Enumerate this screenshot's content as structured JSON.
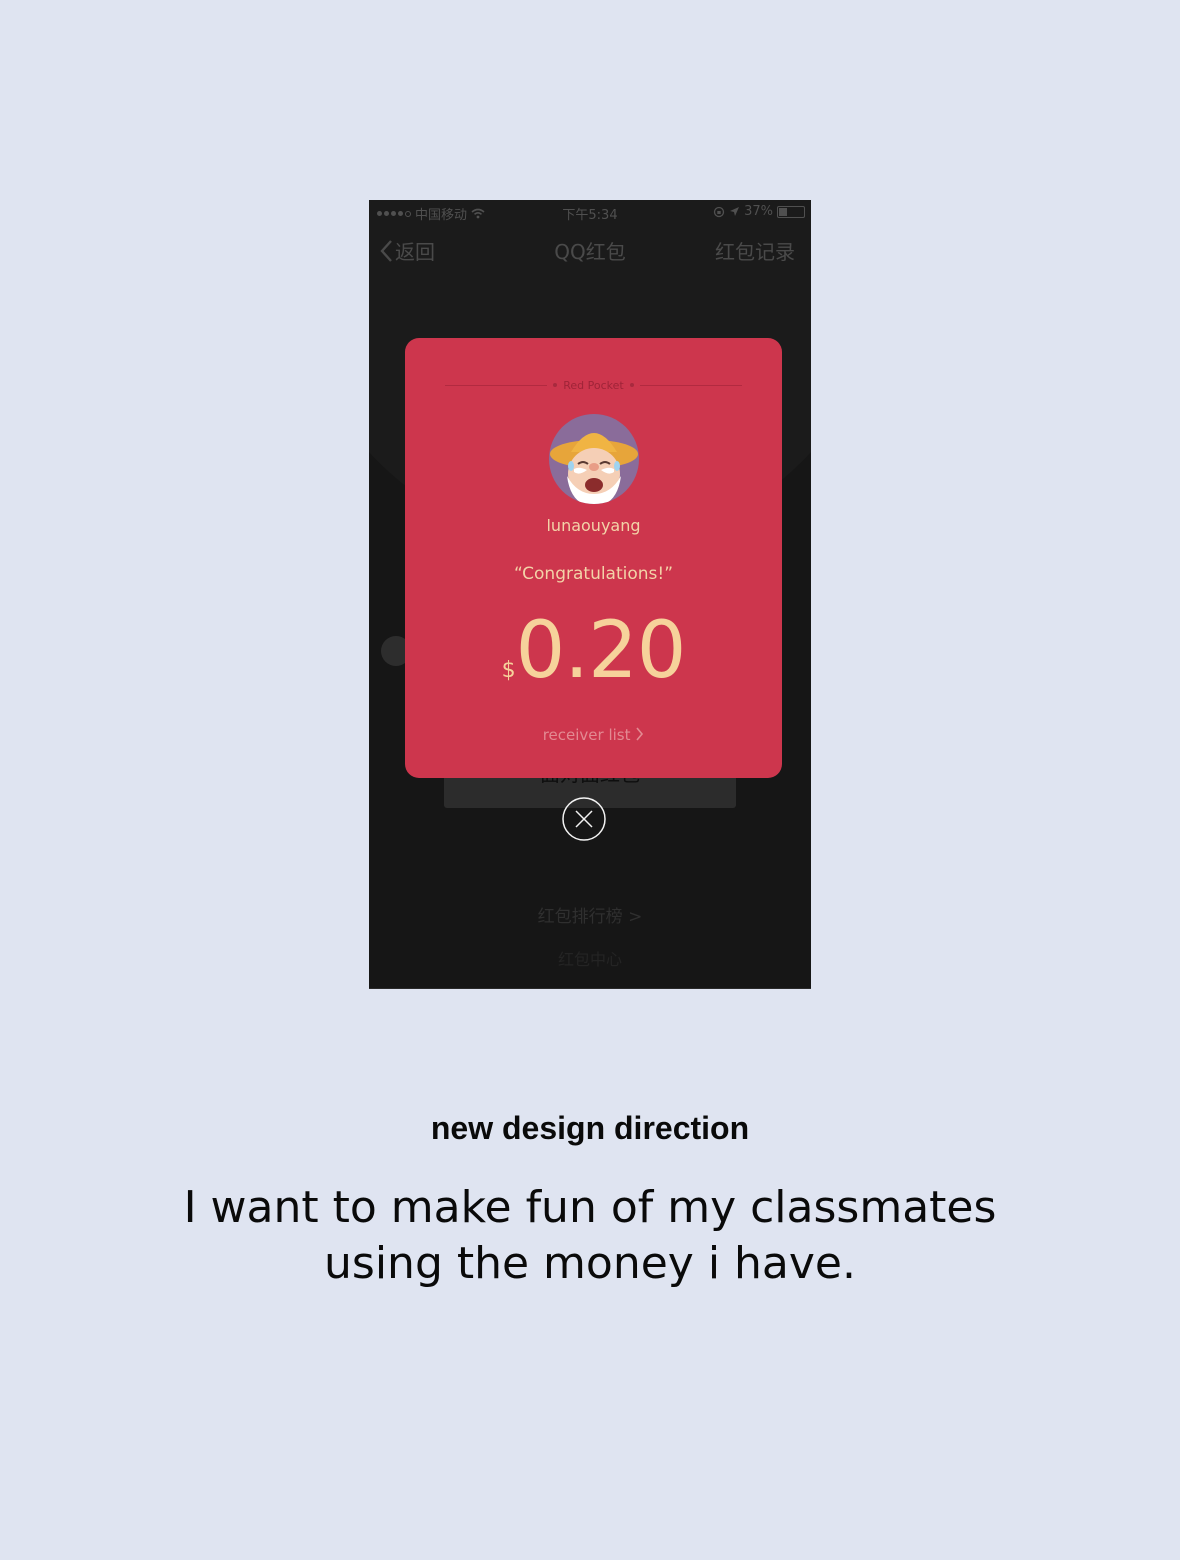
{
  "status_bar": {
    "carrier": "中国移动",
    "time": "下午5:34",
    "battery": "37%"
  },
  "nav": {
    "back_label": "返回",
    "title": "QQ红包",
    "records_label": "红包记录"
  },
  "background": {
    "button_label": "面对面红包",
    "ranking_link": "红包排行榜 >",
    "center_link": "红包中心"
  },
  "card": {
    "header": "Red Pocket",
    "username": "lunaouyang",
    "greeting": "“Congratulations!”",
    "currency": "$",
    "amount": "0.20",
    "receiver_list": "receiver list"
  },
  "caption": {
    "title": "new design direction",
    "line1": "I want to make fun of my classmates",
    "line2": "using the money i have."
  },
  "colors": {
    "page_bg": "#dfe4f1",
    "card_red": "#cd364d",
    "gold_text": "#f6d29b"
  }
}
